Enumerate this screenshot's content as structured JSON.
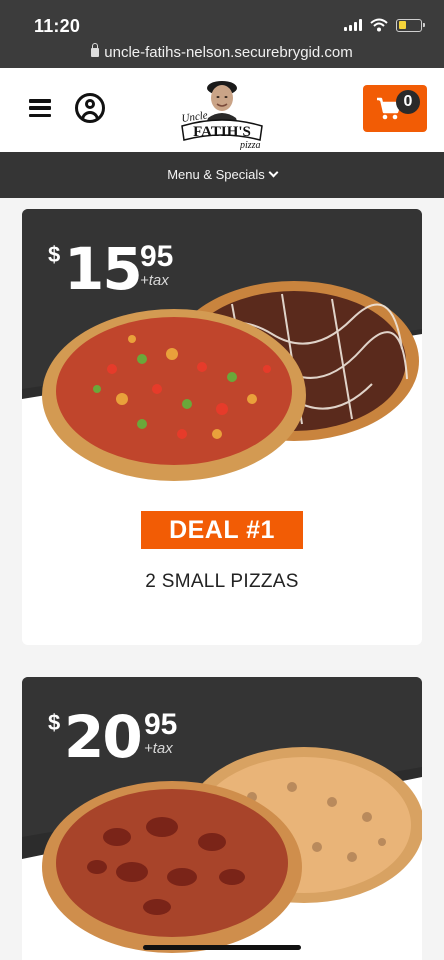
{
  "status_bar": {
    "time": "11:20",
    "url": "uncle-fatihs-nelson.securebrygid.com"
  },
  "header": {
    "logo_text": {
      "uncle": "Uncle",
      "name": "FATIH'S",
      "pizza": "pizza"
    },
    "cart_count": "0"
  },
  "nav": {
    "menu_label": "Menu & Specials"
  },
  "deals": [
    {
      "dollar": "$",
      "price": "15",
      "cents": "95",
      "tax": "+tax",
      "badge": "DEAL #1",
      "description": "2 SMALL PIZZAS"
    },
    {
      "dollar": "$",
      "price": "20",
      "cents": "95",
      "tax": "+tax"
    }
  ],
  "colors": {
    "accent": "#f25c05",
    "dark_bar": "#353535",
    "status_bar": "#3c3c3c"
  },
  "icons": {
    "menu": "hamburger-icon",
    "account": "user-circle-icon",
    "cart": "shopping-cart-icon",
    "nav_chevron": "chevron-down-icon",
    "lock": "lock-icon"
  }
}
